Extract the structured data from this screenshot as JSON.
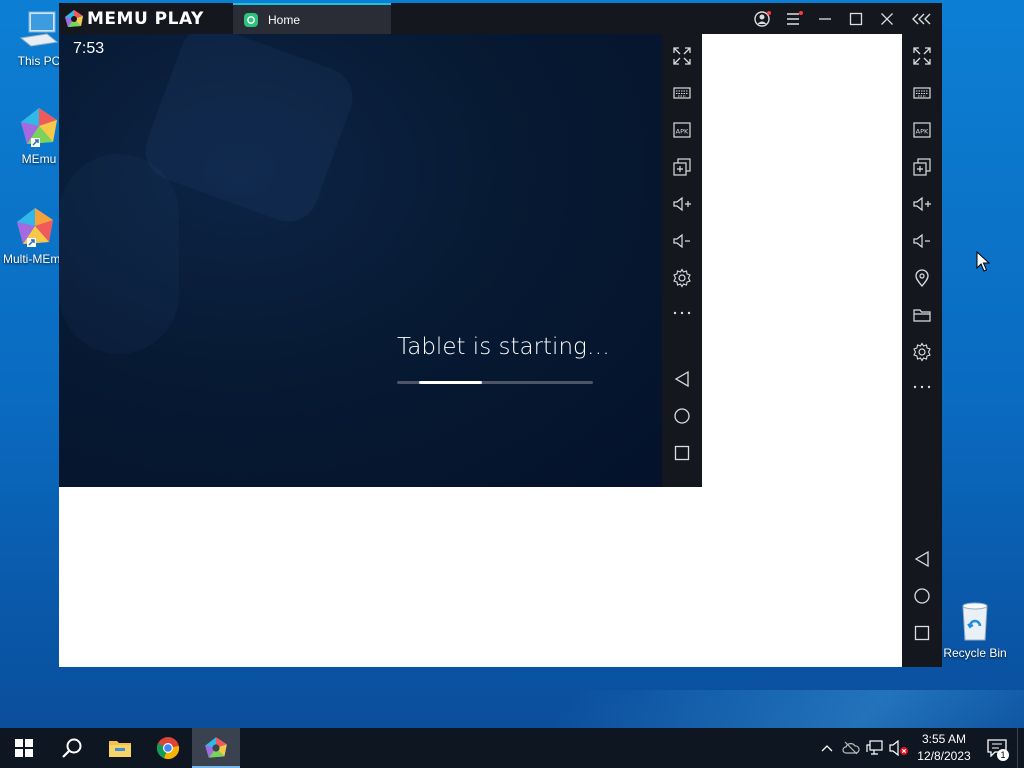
{
  "desktop": {
    "icons": [
      {
        "label": "This PC",
        "icon": "computer-icon"
      },
      {
        "label": "MEmu",
        "icon": "memu-icon"
      },
      {
        "label": "Multi-MEmu",
        "icon": "multi-memu-icon"
      },
      {
        "label": "Recycle Bin",
        "icon": "recycle-bin-icon"
      }
    ]
  },
  "memu": {
    "brand": "MEMU PLAY",
    "tab_label": "Home",
    "colors": {
      "titlebar": "#15171f",
      "tab_accent": "#1fc3d9",
      "screen": "#04122a"
    },
    "window_controls": [
      "account-icon",
      "menu-icon",
      "minimize-icon",
      "maximize-icon",
      "close-icon",
      "collapse-toolbar-icon"
    ],
    "screen": {
      "clock": "7:53",
      "status_text": "Tablet is starting…",
      "progress_fraction": 0.32
    },
    "inner_toolbar": [
      "fullscreen-icon",
      "keyboard-icon",
      "apk-icon",
      "multi-window-icon",
      "volume-up-icon",
      "volume-down-icon",
      "settings-icon",
      "more-icon",
      "back-icon",
      "home-icon",
      "recents-icon"
    ],
    "outer_toolbar": [
      "fullscreen-icon",
      "keyboard-icon",
      "apk-icon",
      "multi-window-icon",
      "volume-up-icon",
      "volume-down-icon",
      "location-icon",
      "folder-icon",
      "settings-icon",
      "more-icon",
      "back-icon",
      "home-icon",
      "recents-icon"
    ],
    "apk_label": "APK"
  },
  "taskbar": {
    "apps": [
      "start-icon",
      "search-icon",
      "file-explorer-icon",
      "chrome-icon",
      "memu-taskbar-icon"
    ],
    "time": "3:55 AM",
    "date": "12/8/2023",
    "notification_count": "1"
  }
}
